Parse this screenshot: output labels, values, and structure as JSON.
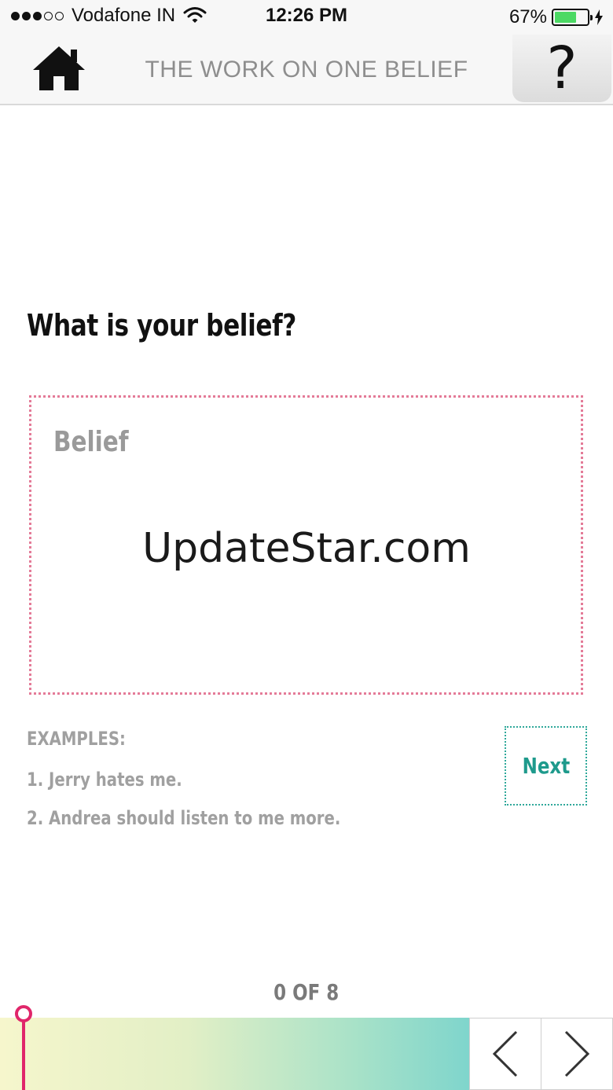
{
  "status_bar": {
    "carrier": "Vodafone IN",
    "time": "12:26 PM",
    "battery_percent": "67%",
    "battery_level": 0.67,
    "signal_strength": 3,
    "signal_max": 5
  },
  "nav": {
    "title": "THE WORK ON ONE BELIEF",
    "home_icon": "home-icon",
    "help_label": "?"
  },
  "main": {
    "question": "What is your belief?",
    "belief_placeholder": "Belief",
    "belief_value": "",
    "watermark": "UpdateStar.com",
    "examples": {
      "heading": "EXAMPLES:",
      "items": [
        "1. Jerry hates me.",
        "2. Andrea should listen to me more."
      ]
    },
    "next_label": "Next"
  },
  "progress": {
    "label": "0 OF 8",
    "current": 0,
    "total": 8
  },
  "colors": {
    "belief_border": "#e47b98",
    "next_accent": "#1e9a8c",
    "marker": "#e0266a",
    "battery": "#4cd964"
  },
  "icons": {
    "prev": "chevron-left-icon",
    "next": "chevron-right-icon"
  }
}
